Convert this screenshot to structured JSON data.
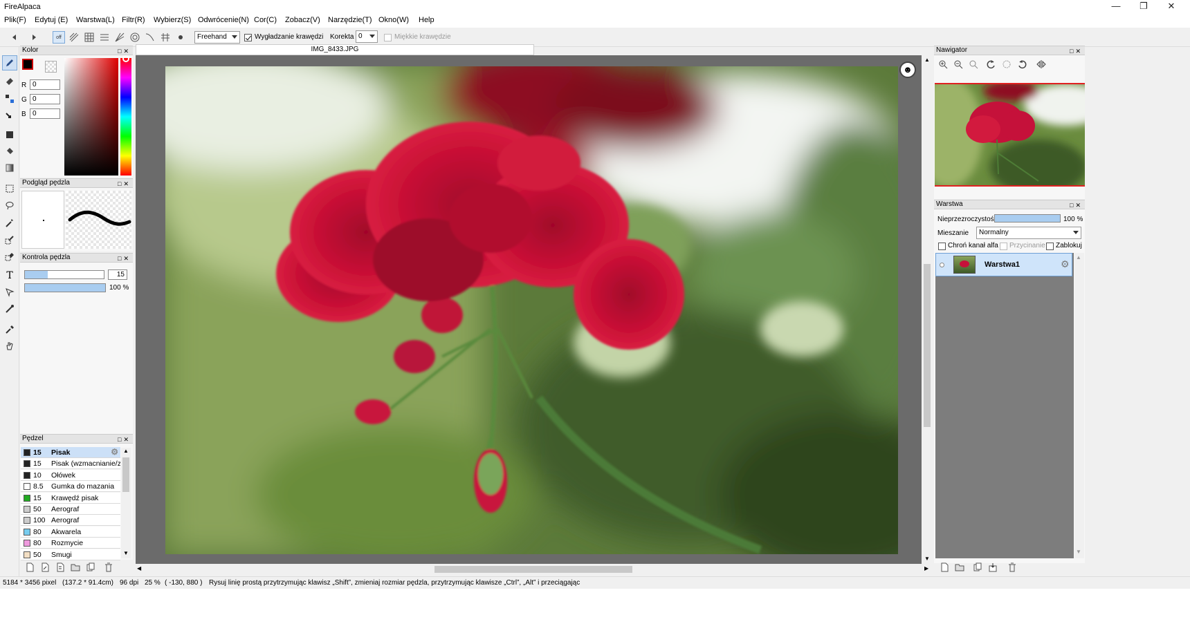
{
  "app": {
    "title": "FireAlpaca"
  },
  "menu": [
    "Plik(F)",
    "Edytuj (E)",
    "Warstwa(L)",
    "Filtr(R)",
    "Wybierz(S)",
    "Odwrócenie(N)",
    "Cor(C)",
    "Zobacz(V)",
    "Narzędzie(T)",
    "Okno(W)",
    "Help"
  ],
  "toolbar": {
    "snap_off_label": "off",
    "brush_mode": "Freehand",
    "antialias_label": "Wygładzanie krawędzi",
    "correction_label": "Korekta",
    "correction_value": "0",
    "soft_edges_label": "Miękkie krawędzie"
  },
  "color_panel": {
    "title": "Kolor",
    "r_label": "R",
    "r_value": "0",
    "g_label": "G",
    "g_value": "0",
    "b_label": "B",
    "b_value": "0",
    "primary_color": "#000000"
  },
  "brush_preview": {
    "title": "Podgląd pędzla"
  },
  "brush_control": {
    "title": "Kontrola pędzla",
    "size_value": "15",
    "size_level": 0.29,
    "opacity_value": "100 %",
    "opacity_level": 1.0
  },
  "brush_panel": {
    "title": "Pędzel",
    "items": [
      {
        "size": "15",
        "name": "Pisak",
        "color": "#222222",
        "selected": true
      },
      {
        "size": "15",
        "name": "Pisak (wzmacnianie/zan",
        "color": "#222222"
      },
      {
        "size": "10",
        "name": "Ołówek",
        "color": "#222222"
      },
      {
        "size": "8.5",
        "name": "Gumka do mazania",
        "color": "#ffffff"
      },
      {
        "size": "15",
        "name": "Krawędź pisak",
        "color": "#22aa22"
      },
      {
        "size": "50",
        "name": "Aerograf",
        "color": "#cccccc"
      },
      {
        "size": "100",
        "name": "Aerograf",
        "color": "#cccccc"
      },
      {
        "size": "80",
        "name": "Akwarela",
        "color": "#77ccee"
      },
      {
        "size": "80",
        "name": "Rozmycie",
        "color": "#ee99dd"
      },
      {
        "size": "50",
        "name": "Smugi",
        "color": "#f3dfc4"
      }
    ]
  },
  "document": {
    "tab_name": "IMG_8433.JPG"
  },
  "navigator": {
    "title": "Nawigator"
  },
  "layer_panel": {
    "title": "Warstwa",
    "opacity_label": "Nieprzezroczystość",
    "opacity_value": "100 %",
    "opacity_level": 1.0,
    "blend_label": "Mieszanie",
    "blend_value": "Normalny",
    "protect_alpha_label": "Chroń kanał alfa",
    "clipping_label": "Przycinanie",
    "lock_label": "Zablokuj",
    "layers": [
      {
        "name": "Warstwa1"
      }
    ]
  },
  "status": {
    "image_size": "5184 * 3456 pixel",
    "physical_size": "(137.2 * 91.4cm)",
    "dpi": "96 dpi",
    "zoom": "25 %",
    "cursor": "( -130, 880 )",
    "hint": "Rysuj linię prostą przytrzymując klawisz „Shift”, zmieniaj rozmiar pędzla, przytrzymując klawisze „Ctrl”, „Alt” i przeciągając"
  }
}
